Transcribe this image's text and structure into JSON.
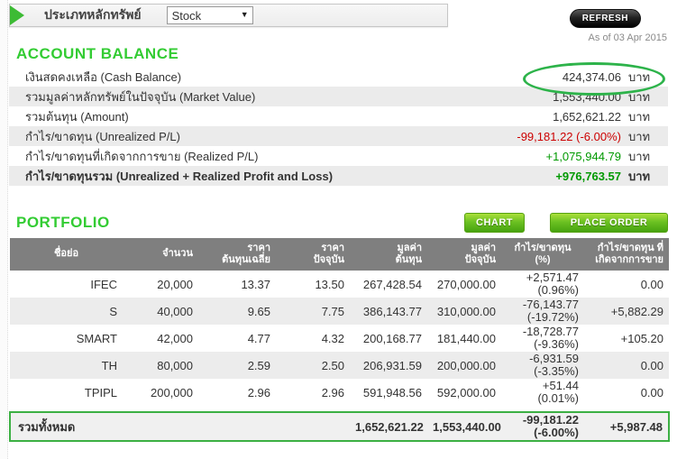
{
  "icons": {
    "dropdown_arrow": "▼"
  },
  "topbar": {
    "filter_label": "ประเภทหลักทรัพย์",
    "filter_value": "Stock",
    "refresh_label": "REFRESH"
  },
  "as_of": "As of 03 Apr 2015",
  "account_balance": {
    "title": "ACCOUNT BALANCE",
    "rows": [
      {
        "label": "เงินสดคงเหลือ (Cash Balance)",
        "value": "424,374.06",
        "unit": "บาท"
      },
      {
        "label": "รวมมูลค่าหลักทรัพย์ในปัจจุบัน (Market Value)",
        "value": "1,553,440.00",
        "unit": "บาท"
      },
      {
        "label": "รวมต้นทุน (Amount)",
        "value": "1,652,621.22",
        "unit": "บาท"
      },
      {
        "label": "กำไร/ขาดทุน (Unrealized P/L)",
        "value": "-99,181.22 (-6.00%)",
        "unit": "บาท"
      },
      {
        "label": "กำไร/ขาดทุนที่เกิดจากการขาย (Realized P/L)",
        "value": "+1,075,944.79",
        "unit": "บาท"
      },
      {
        "label": "กำไร/ขาดทุนรวม (Unrealized + Realized Profit and Loss)",
        "value": "+976,763.57",
        "unit": "บาท"
      }
    ]
  },
  "portfolio": {
    "title": "PORTFOLIO",
    "buttons": {
      "chart": "CHART",
      "place_order": "PLACE ORDER"
    },
    "columns": [
      {
        "l1": "ชื่อย่อ",
        "l2": ""
      },
      {
        "l1": "จำนวน",
        "l2": ""
      },
      {
        "l1": "ราคา",
        "l2": "ต้นทุนเฉลี่ย"
      },
      {
        "l1": "ราคา",
        "l2": "ปัจจุบัน"
      },
      {
        "l1": "มูลค่า",
        "l2": "ต้นทุน"
      },
      {
        "l1": "มูลค่า",
        "l2": "ปัจจุบัน"
      },
      {
        "l1": "กำไร/ขาดทุน (%)",
        "l2": ""
      },
      {
        "l1": "กำไร/ขาดทุน ที่",
        "l2": "เกิดจากการขาย"
      }
    ],
    "rows": [
      {
        "symbol": "IFEC",
        "qty": "20,000",
        "avg_cost": "13.37",
        "last": "13.50",
        "cost_value": "267,428.54",
        "market_value": "270,000.00",
        "pl": "+2,571.47",
        "pl_pct": "(0.96%)",
        "realized": "0.00"
      },
      {
        "symbol": "S",
        "qty": "40,000",
        "avg_cost": "9.65",
        "last": "7.75",
        "cost_value": "386,143.77",
        "market_value": "310,000.00",
        "pl": "-76,143.77",
        "pl_pct": "(-19.72%)",
        "realized": "+5,882.29"
      },
      {
        "symbol": "SMART",
        "qty": "42,000",
        "avg_cost": "4.77",
        "last": "4.32",
        "cost_value": "200,168.77",
        "market_value": "181,440.00",
        "pl": "-18,728.77",
        "pl_pct": "(-9.36%)",
        "realized": "+105.20"
      },
      {
        "symbol": "TH",
        "qty": "80,000",
        "avg_cost": "2.59",
        "last": "2.50",
        "cost_value": "206,931.59",
        "market_value": "200,000.00",
        "pl": "-6,931.59",
        "pl_pct": "(-3.35%)",
        "realized": "0.00"
      },
      {
        "symbol": "TPIPL",
        "qty": "200,000",
        "avg_cost": "2.96",
        "last": "2.96",
        "cost_value": "591,948.56",
        "market_value": "592,000.00",
        "pl": "+51.44",
        "pl_pct": "(0.01%)",
        "realized": "0.00"
      }
    ],
    "total": {
      "label": "รวมทั้งหมด",
      "cost_value": "1,652,621.22",
      "market_value": "1,553,440.00",
      "pl": "-99,181.22",
      "pl_pct": "(-6.00%)",
      "realized": "+5,987.48"
    }
  },
  "colors": {
    "accent_green": "#33cc33",
    "positive": "#009900",
    "negative": "#cc0000",
    "header_gray": "#7f7f7f",
    "annotation_green": "#2db34a",
    "button_green": "#6cc122"
  }
}
